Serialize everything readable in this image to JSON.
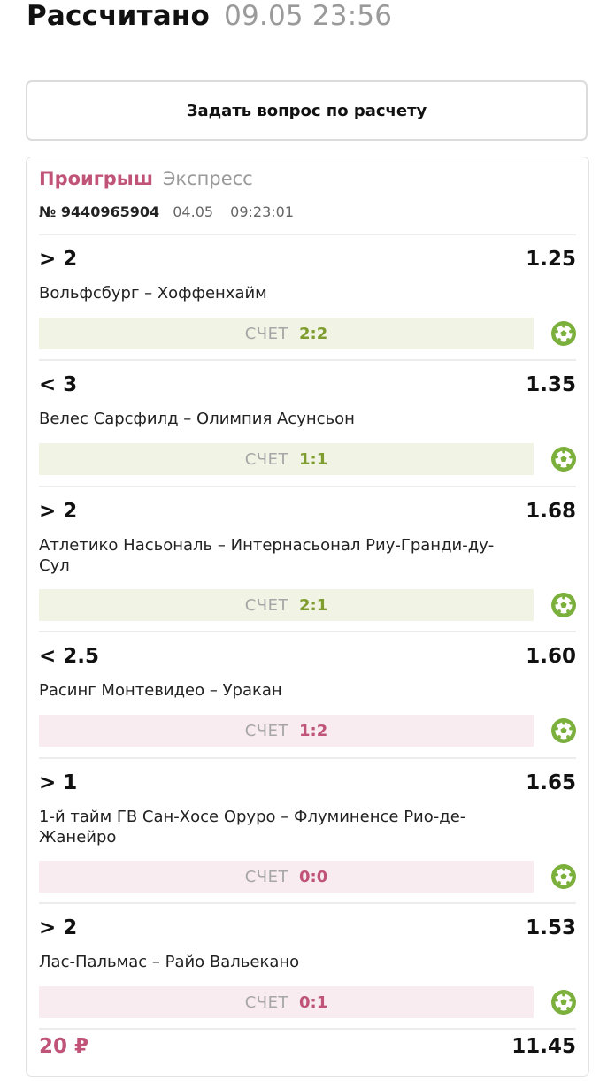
{
  "header": {
    "title": "Рассчитано",
    "timestamp": "09.05 23:56"
  },
  "ask_button": {
    "label": "Задать вопрос по расчету"
  },
  "bet": {
    "status": "Проигрыш",
    "type": "Экспресс",
    "number": "№ 9440965904",
    "date": "04.05",
    "time": "09:23:01",
    "score_label": "СЧЕТ",
    "events": [
      {
        "outcome": "> 2",
        "odds": "1.25",
        "match": "Вольфсбург – Хоффенхайм",
        "score": "2:2",
        "result": "win"
      },
      {
        "outcome": "< 3",
        "odds": "1.35",
        "match": "Велес Сарсфилд – Олимпия Асунсьон",
        "score": "1:1",
        "result": "win"
      },
      {
        "outcome": "> 2",
        "odds": "1.68",
        "match": "Атлетико Насьональ – Интернасьонал Риу-Гранди-ду-Сул",
        "score": "2:1",
        "result": "win"
      },
      {
        "outcome": "< 2.5",
        "odds": "1.60",
        "match": "Расинг Монтевидео – Уракан",
        "score": "1:2",
        "result": "lose"
      },
      {
        "outcome": "> 1",
        "odds": "1.65",
        "match": "1-й тайм ГВ Сан-Хосе Оруро – Флуминенсе Рио-де-Жанейро",
        "score": "0:0",
        "result": "lose"
      },
      {
        "outcome": "> 2",
        "odds": "1.53",
        "match": "Лас-Пальмас – Райо Вальекано",
        "score": "0:1",
        "result": "lose"
      }
    ],
    "stake": "20 ₽",
    "total_odds": "11.45"
  },
  "icons": {
    "sport": "soccer-ball-icon"
  },
  "colors": {
    "lose": "#c05478",
    "win": "#7f9c2e",
    "win_bg": "#f1f4e5",
    "lose_bg": "#f9ecf0",
    "ball": "#7cb03c"
  }
}
